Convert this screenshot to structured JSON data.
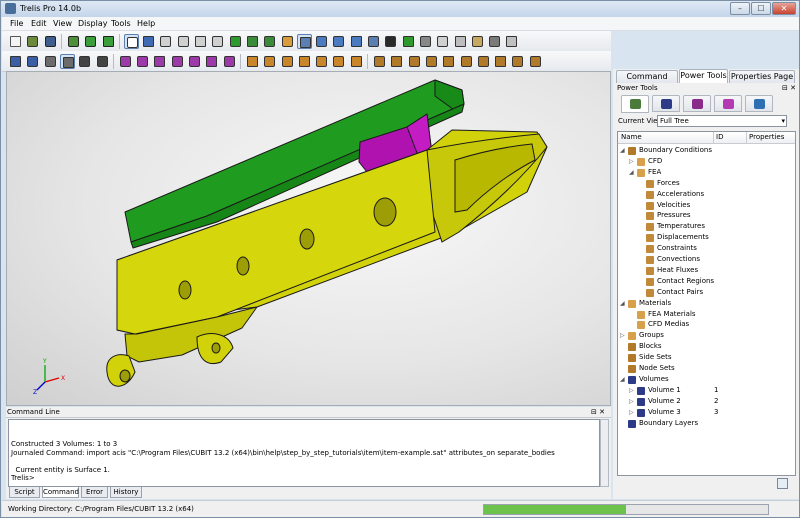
{
  "window": {
    "title": "Trelis Pro 14.0b",
    "buttons": [
      "–",
      "☐",
      "✕"
    ]
  },
  "menu": [
    "File",
    "Edit",
    "View",
    "Display",
    "Tools",
    "Help"
  ],
  "toolbar1": [
    {
      "icon": "new-file-icon",
      "c": "#f4f4f4",
      "b": "#555"
    },
    {
      "icon": "open-file-icon",
      "c": "#6c8a3c",
      "b": "#333"
    },
    {
      "icon": "save-icon",
      "c": "#3d5f8c",
      "b": "#222"
    },
    {
      "sep": true
    },
    {
      "icon": "record-journal-icon",
      "c": "#4e8f3a",
      "b": "#222"
    },
    {
      "icon": "play-journal-icon",
      "c": "#3a9f3a",
      "b": "#222"
    },
    {
      "icon": "pause-journal-icon",
      "c": "#3a9f3a",
      "b": "#222"
    },
    {
      "sep": true
    },
    {
      "icon": "select-pointer-icon",
      "c": "#ffffff",
      "b": "#333",
      "pressed": true
    },
    {
      "icon": "rotate-view-icon",
      "c": "#3d6ab3",
      "b": "#333"
    },
    {
      "icon": "view-front-icon",
      "c": "#d0d0d0",
      "b": "#333"
    },
    {
      "icon": "view-back-icon",
      "c": "#d0d0d0",
      "b": "#333"
    },
    {
      "icon": "view-left-icon",
      "c": "#d0d0d0",
      "b": "#333"
    },
    {
      "icon": "view-right-icon",
      "c": "#d0d0d0",
      "b": "#333"
    },
    {
      "icon": "view-iso-icon",
      "c": "#2d9a2d",
      "b": "#333"
    },
    {
      "icon": "view-iso2-icon",
      "c": "#3a8a3a",
      "b": "#333"
    },
    {
      "icon": "view-iso3-icon",
      "c": "#3a8a3a",
      "b": "#333"
    },
    {
      "icon": "perspective-icon",
      "c": "#d89c3a",
      "b": "#333"
    },
    {
      "icon": "zoom-box-icon",
      "c": "#5a7fb0",
      "b": "#333",
      "pressed": true
    },
    {
      "icon": "zoom-in-icon",
      "c": "#4a7bc0",
      "b": "#333"
    },
    {
      "icon": "zoom-out-icon",
      "c": "#4a7bc0",
      "b": "#333"
    },
    {
      "icon": "pan-icon",
      "c": "#4a7bc0",
      "b": "#333"
    },
    {
      "icon": "fit-all-icon",
      "c": "#5a7fb0",
      "b": "#333"
    },
    {
      "icon": "wireframe-icon",
      "c": "#2a2a2a",
      "b": "#333"
    },
    {
      "icon": "shaded-icon",
      "c": "#2e9a2e",
      "b": "#333"
    },
    {
      "icon": "hidden-line-icon",
      "c": "#888",
      "b": "#333"
    },
    {
      "icon": "transparent-icon",
      "c": "#d0d0d0",
      "b": "#333"
    },
    {
      "icon": "smooth-shade-icon",
      "c": "#bdbdbd",
      "b": "#333"
    },
    {
      "icon": "clipping-icon",
      "c": "#c7a860",
      "b": "#333"
    },
    {
      "icon": "mesh-display-icon",
      "c": "#7a7a7a",
      "b": "#333"
    },
    {
      "icon": "refresh-icon",
      "c": "#c0c0c0",
      "b": "#333"
    }
  ],
  "toolbar2": [
    {
      "icon": "select-volume-icon",
      "c": "#3a5fa5",
      "b": "#333"
    },
    {
      "icon": "select-surface-icon",
      "c": "#3a5fa5",
      "b": "#333"
    },
    {
      "icon": "select-curve-icon",
      "c": "#6b6b6b",
      "b": "#333"
    },
    {
      "icon": "select-face-icon",
      "c": "#6b6b6b",
      "b": "#333",
      "pressed": true
    },
    {
      "icon": "select-edge-icon",
      "c": "#444",
      "b": "#333"
    },
    {
      "icon": "select-vertex-icon",
      "c": "#444",
      "b": "#333"
    },
    {
      "sep": true
    },
    {
      "icon": "node-filter-icon",
      "c": "#9b3aa8",
      "b": "#333"
    },
    {
      "icon": "edge-filter-icon",
      "c": "#9b3aa8",
      "b": "#333"
    },
    {
      "icon": "quad-filter-icon",
      "c": "#9b3aa8",
      "b": "#333"
    },
    {
      "icon": "tri-filter-icon",
      "c": "#9b3aa8",
      "b": "#333"
    },
    {
      "icon": "hex-filter-icon",
      "c": "#9b3aa8",
      "b": "#333"
    },
    {
      "icon": "tet-filter-icon",
      "c": "#9b3aa8",
      "b": "#333"
    },
    {
      "icon": "wedge-filter-icon",
      "c": "#9b3aa8",
      "b": "#333"
    },
    {
      "sep": true
    },
    {
      "icon": "group-icon",
      "c": "#c8852a",
      "b": "#333"
    },
    {
      "icon": "body-icon",
      "c": "#c8852a",
      "b": "#333"
    },
    {
      "icon": "imprint-icon",
      "c": "#c8852a",
      "b": "#333"
    },
    {
      "icon": "merge-icon",
      "c": "#c8852a",
      "b": "#333"
    },
    {
      "icon": "webcut-icon",
      "c": "#c8852a",
      "b": "#333"
    },
    {
      "icon": "sweep-icon",
      "c": "#c8852a",
      "b": "#333"
    },
    {
      "icon": "boolean-icon",
      "c": "#c8852a",
      "b": "#333"
    },
    {
      "sep": true
    },
    {
      "icon": "bc-force-icon",
      "c": "#b07a2a",
      "b": "#333"
    },
    {
      "icon": "bc-pressure-icon",
      "c": "#b07a2a",
      "b": "#333"
    },
    {
      "icon": "bc-temperature-icon",
      "c": "#b07a2a",
      "b": "#333"
    },
    {
      "icon": "bc-displacement-icon",
      "c": "#b07a2a",
      "b": "#333"
    },
    {
      "icon": "bc-heatflux-icon",
      "c": "#b07a2a",
      "b": "#333"
    },
    {
      "icon": "bc-convection-icon",
      "c": "#b07a2a",
      "b": "#333"
    },
    {
      "icon": "material-icon",
      "c": "#b07a2a",
      "b": "#333"
    },
    {
      "icon": "blocks-icon",
      "c": "#b07a2a",
      "b": "#333"
    },
    {
      "icon": "sidesets-icon",
      "c": "#b07a2a",
      "b": "#333"
    },
    {
      "icon": "nodesets-icon",
      "c": "#b07a2a",
      "b": "#333"
    }
  ],
  "model_colors": {
    "body": "#d2d20a",
    "rail": "#1f9b1f",
    "block": "#b012b0",
    "edge": "#1a1a1a"
  },
  "axes": {
    "x": "X",
    "y": "Y",
    "z": "Z"
  },
  "right_panel": {
    "tabs": [
      "Command Panel",
      "Power Tools",
      "Properties Page"
    ],
    "active_tab": 1,
    "header": "Power Tools",
    "header_controls": "⊟ ✕",
    "power_tabs": [
      {
        "icon": "tree-tool-icon",
        "c": "#4a7b3a"
      },
      {
        "icon": "geometry-tool-icon",
        "c": "#2d3a88"
      },
      {
        "icon": "mesh-tool-icon",
        "c": "#8a2a8a"
      },
      {
        "icon": "analysis-tool-icon",
        "c": "#b43ab4"
      },
      {
        "icon": "check-tool-icon",
        "c": "#2d6fb3"
      }
    ],
    "current_view_label": "Current View",
    "current_view_value": "Full Tree",
    "columns": [
      "Name",
      "ID",
      "Properties"
    ],
    "tree": [
      {
        "label": "Boundary Conditions",
        "level": 0,
        "tw": "◢",
        "ic": "#b07a2a"
      },
      {
        "label": "CFD",
        "level": 1,
        "tw": "▷",
        "ic": "#d8a04a"
      },
      {
        "label": "FEA",
        "level": 1,
        "tw": "◢",
        "ic": "#d8a04a"
      },
      {
        "label": "Forces",
        "level": 2,
        "tw": "",
        "ic": "#c08a3a"
      },
      {
        "label": "Accelerations",
        "level": 2,
        "tw": "",
        "ic": "#c08a3a"
      },
      {
        "label": "Velocities",
        "level": 2,
        "tw": "",
        "ic": "#c08a3a"
      },
      {
        "label": "Pressures",
        "level": 2,
        "tw": "",
        "ic": "#c08a3a"
      },
      {
        "label": "Temperatures",
        "level": 2,
        "tw": "",
        "ic": "#c08a3a"
      },
      {
        "label": "Displacements",
        "level": 2,
        "tw": "",
        "ic": "#c08a3a"
      },
      {
        "label": "Constraints",
        "level": 2,
        "tw": "",
        "ic": "#c08a3a"
      },
      {
        "label": "Convections",
        "level": 2,
        "tw": "",
        "ic": "#c08a3a"
      },
      {
        "label": "Heat Fluxes",
        "level": 2,
        "tw": "",
        "ic": "#c08a3a"
      },
      {
        "label": "Contact Regions",
        "level": 2,
        "tw": "",
        "ic": "#c08a3a"
      },
      {
        "label": "Contact Pairs",
        "level": 2,
        "tw": "",
        "ic": "#c08a3a"
      },
      {
        "label": "Materials",
        "level": 0,
        "tw": "◢",
        "ic": "#d8a04a"
      },
      {
        "label": "FEA Materials",
        "level": 1,
        "tw": "",
        "ic": "#d8a04a"
      },
      {
        "label": "CFD Medias",
        "level": 1,
        "tw": "",
        "ic": "#d8a04a"
      },
      {
        "label": "Groups",
        "level": 0,
        "tw": "▷",
        "ic": "#d8a04a"
      },
      {
        "label": "Blocks",
        "level": 0,
        "tw": "",
        "ic": "#b07a2a"
      },
      {
        "label": "Side Sets",
        "level": 0,
        "tw": "",
        "ic": "#b07a2a"
      },
      {
        "label": "Node Sets",
        "level": 0,
        "tw": "",
        "ic": "#b07a2a"
      },
      {
        "label": "Volumes",
        "level": 0,
        "tw": "◢",
        "ic": "#2d3a88"
      },
      {
        "label": "Volume 1",
        "level": 1,
        "tw": "▷",
        "ic": "#2d3a88",
        "id": "1"
      },
      {
        "label": "Volume 2",
        "level": 1,
        "tw": "▷",
        "ic": "#2d3a88",
        "id": "2"
      },
      {
        "label": "Volume 3",
        "level": 1,
        "tw": "▷",
        "ic": "#2d3a88",
        "id": "3"
      },
      {
        "label": "Boundary Layers",
        "level": 0,
        "tw": "",
        "ic": "#2d3a88"
      }
    ]
  },
  "command_line": {
    "title": "Command Line",
    "controls": "⊟ ✕",
    "lines": [
      "Constructed 3 Volumes: 1 to 3",
      "Journaled Command: import acis \"C:\\Program Files\\CUBIT 13.2 (x64)\\bin\\help\\step_by_step_tutorials\\item\\item-example.sat\" attributes_on separate_bodies",
      "",
      "  Current entity is Surface 1.",
      "Trelis>"
    ],
    "tabs": [
      "Script",
      "Command",
      "Error",
      "History"
    ],
    "active_tab": 1
  },
  "status": {
    "text": "Working Directory: C:/Program Files/CUBIT 13.2 (x64)",
    "progress": 0.5
  }
}
